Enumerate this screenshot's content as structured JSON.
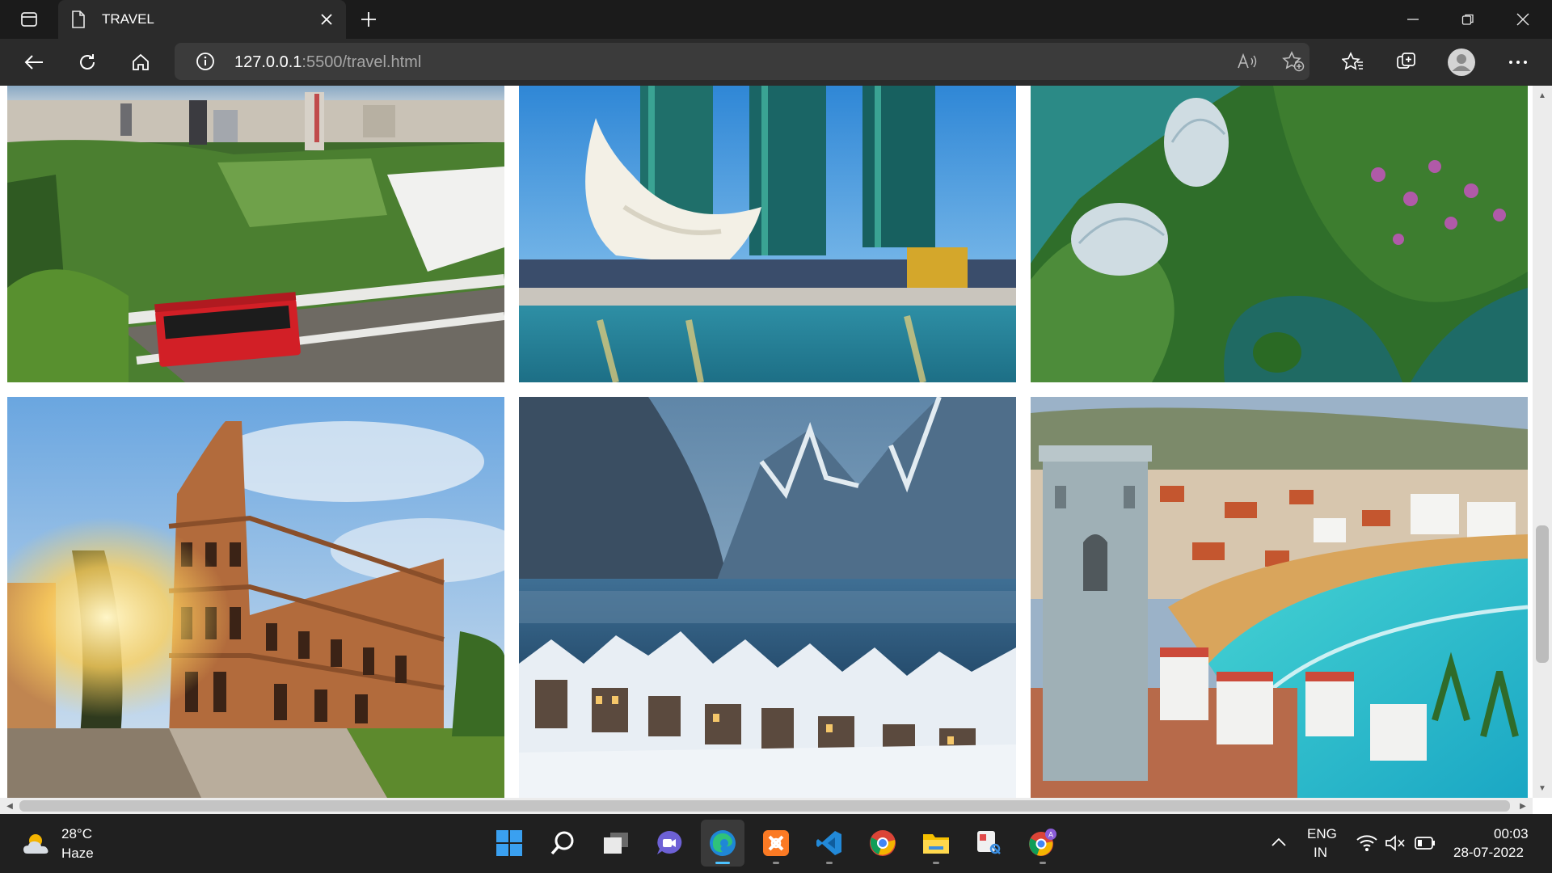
{
  "browser": {
    "tab_title": "TRAVEL",
    "url_host": "127.0.0.1",
    "url_rest": ":5500/travel.html",
    "icons": [
      "sidebar-icon",
      "page-icon",
      "close-icon",
      "new-tab-icon",
      "minimize-icon",
      "restore-icon",
      "window-close-icon",
      "back-icon",
      "refresh-icon",
      "home-icon",
      "info-icon",
      "read-aloud-icon",
      "add-favorite-icon",
      "favorites-icon",
      "collections-icon",
      "profile-icon",
      "more-icon"
    ]
  },
  "gallery": {
    "images": [
      {
        "subject": "wellington-cable-car"
      },
      {
        "subject": "singapore-marina-bay"
      },
      {
        "subject": "gardens-by-the-bay"
      },
      {
        "subject": "rome-colosseum"
      },
      {
        "subject": "hallstatt-winter"
      },
      {
        "subject": "peniscola-coast"
      }
    ]
  },
  "taskbar": {
    "weather_temp": "28°C",
    "weather_desc": "Haze",
    "lang_top": "ENG",
    "lang_bottom": "IN",
    "time": "00:03",
    "date": "28-07-2022",
    "apps": [
      "start-icon",
      "search-icon",
      "task-view-icon",
      "chat-icon",
      "edge-icon",
      "xampp-icon",
      "vscode-icon",
      "chrome-icon",
      "file-explorer-icon",
      "snipping-tool-icon",
      "chrome-profile-icon"
    ]
  },
  "colors": {
    "titlebar": "#1b1b1b",
    "navbar": "#2b2b2b",
    "taskbar": "#202020",
    "accent": "#4cc2ff"
  }
}
